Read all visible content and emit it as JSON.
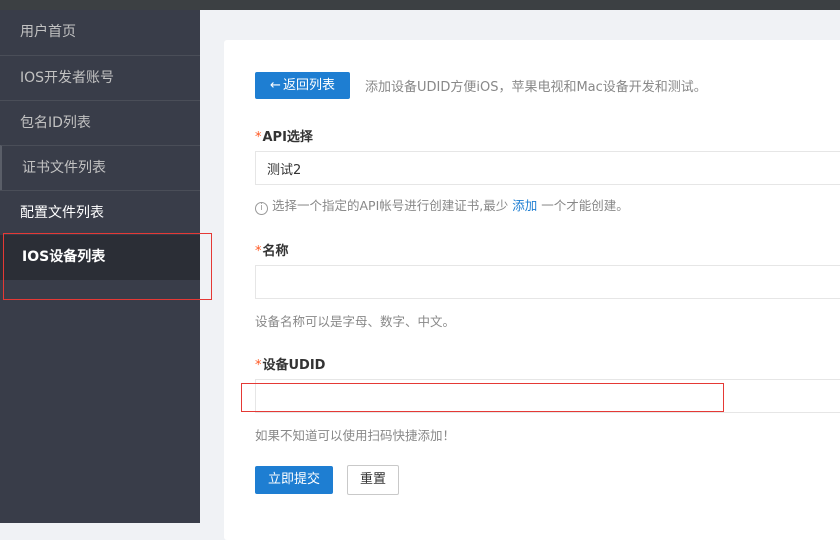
{
  "sidebar": {
    "items": [
      {
        "label": "用户首页"
      },
      {
        "label": "IOS开发者账号"
      },
      {
        "label": "包名ID列表"
      },
      {
        "label": "证书文件列表"
      },
      {
        "label": "配置文件列表"
      },
      {
        "label": "IOS设备列表"
      }
    ]
  },
  "form": {
    "back_button": {
      "icon": "←",
      "label": "返回列表"
    },
    "description": "添加设备UDID方便iOS，苹果电视和Mac设备开发和测试。",
    "required_mark": "*",
    "api": {
      "label": "API选择",
      "value": "测试2",
      "hint_icon": "i",
      "hint_before": "选择一个指定的API帐号进行创建证书,最少",
      "hint_link": "添加",
      "hint_after": "一个才能创建。"
    },
    "name": {
      "label": "名称",
      "value": "",
      "hint": "设备名称可以是字母、数字、中文。"
    },
    "udid": {
      "label": "设备UDID",
      "value": "",
      "hint": "如果不知道可以使用扫码快捷添加！"
    },
    "submit_label": "立即提交",
    "reset_label": "重置"
  },
  "colors": {
    "accent": "#1e7ed2",
    "sidebar_bg": "#393d49",
    "sidebar_active_bg": "#2b2e36",
    "required": "#ff5722",
    "highlight_box": "#e53935"
  }
}
